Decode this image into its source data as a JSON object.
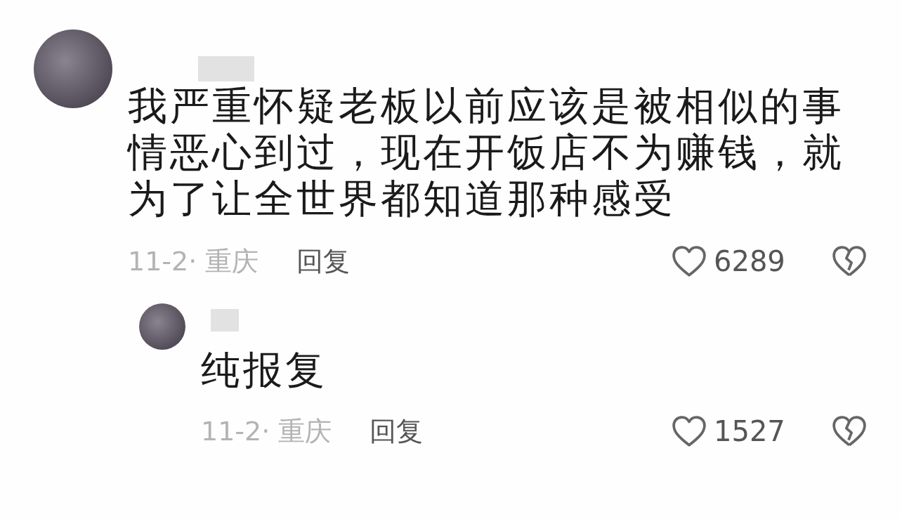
{
  "comments": [
    {
      "text": "我严重怀疑老板以前应该是被相似的事情恶心到过，现在开饭店不为赚钱，就为了让全世界都知道那种感受",
      "date_location": "11-2· 重庆",
      "reply_label": "回复",
      "like_count": "6289",
      "replies": [
        {
          "text": "纯报复",
          "date_location": "11-2· 重庆",
          "reply_label": "回复",
          "like_count": "1527"
        }
      ]
    }
  ]
}
